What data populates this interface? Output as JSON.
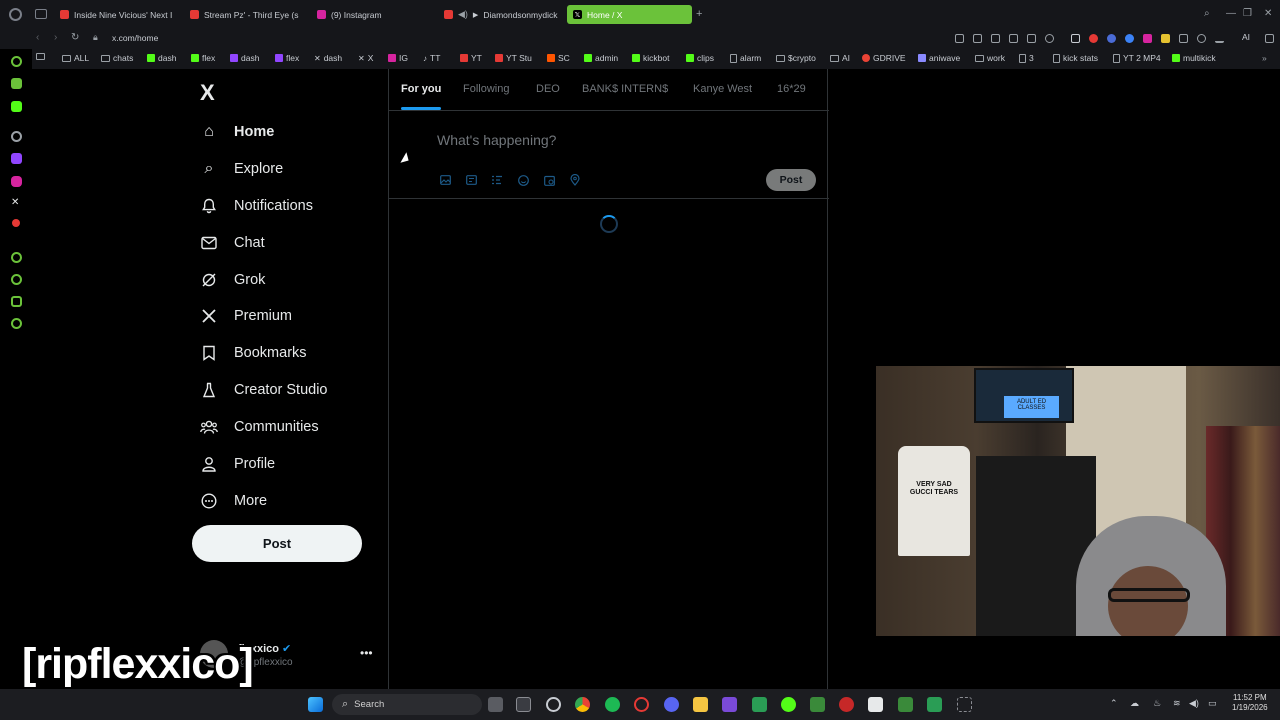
{
  "browser": {
    "tabs": [
      {
        "label": "Inside Nine Vicious' Next I",
        "color": "#e53935"
      },
      {
        "label": "Stream Pz' - Third Eye (s",
        "color": "#e53935"
      },
      {
        "label": "(9) Instagram",
        "color": "#d6249f"
      },
      {
        "label": "Diamondsonmydick",
        "color": "#e53935"
      },
      {
        "label": "Home / X",
        "color": "#000000"
      }
    ],
    "url": "x.com/home",
    "ai_label": "AI",
    "bookmarks": [
      {
        "label": "ALL",
        "icon": "folder-icon"
      },
      {
        "label": "chats",
        "icon": "folder-icon"
      },
      {
        "label": "dash",
        "icon": "kick-icon",
        "color": "#53fc18"
      },
      {
        "label": "flex",
        "icon": "kick-icon",
        "color": "#53fc18"
      },
      {
        "label": "dash",
        "icon": "twitch-icon",
        "color": "#9146ff"
      },
      {
        "label": "flex",
        "icon": "twitch-icon",
        "color": "#9146ff"
      },
      {
        "label": "dash",
        "icon": "x-icon",
        "color": "#e7e9ea"
      },
      {
        "label": "X",
        "icon": "x-icon",
        "color": "#e7e9ea"
      },
      {
        "label": "IG",
        "icon": "instagram-icon",
        "color": "#d6249f"
      },
      {
        "label": "TT",
        "icon": "tiktok-icon",
        "color": "#e7e9ea"
      },
      {
        "label": "YT",
        "icon": "youtube-icon",
        "color": "#e53935"
      },
      {
        "label": "YT Stu",
        "icon": "youtube-icon",
        "color": "#e53935"
      },
      {
        "label": "SC",
        "icon": "soundcloud-icon",
        "color": "#ff5500"
      },
      {
        "label": "admin",
        "icon": "lock-icon",
        "color": "#53fc18"
      },
      {
        "label": "kickbot",
        "icon": "kick-icon",
        "color": "#53fc18"
      },
      {
        "label": "clips",
        "icon": "kick-icon",
        "color": "#53fc18"
      },
      {
        "label": "alarm",
        "icon": "page-icon",
        "color": "#c8ccd2"
      },
      {
        "label": "$crypto",
        "icon": "folder-icon"
      },
      {
        "label": "AI",
        "icon": "folder-icon"
      },
      {
        "label": "GDRIVE",
        "icon": "google-icon",
        "color": "#ea4335"
      },
      {
        "label": "aniwave",
        "icon": "aniwave-icon",
        "color": "#8a8aff"
      },
      {
        "label": "work",
        "icon": "folder-icon"
      },
      {
        "label": "3",
        "icon": "page-icon",
        "color": "#c8ccd2"
      },
      {
        "label": "kick stats",
        "icon": "page-icon",
        "color": "#c8ccd2"
      },
      {
        "label": "YT 2 MP4",
        "icon": "page-icon",
        "color": "#c8ccd2"
      },
      {
        "label": "multikick",
        "icon": "kick-icon",
        "color": "#53fc18"
      }
    ]
  },
  "x": {
    "logo": "X",
    "nav": [
      {
        "label": "Home",
        "icon": "home-icon",
        "glyph": "⌂",
        "active": true
      },
      {
        "label": "Explore",
        "icon": "search-icon",
        "glyph": "⌕"
      },
      {
        "label": "Notifications",
        "icon": "bell-icon",
        "glyph": "♫"
      },
      {
        "label": "Chat",
        "icon": "mail-icon",
        "glyph": "✉"
      },
      {
        "label": "Grok",
        "icon": "grok-icon",
        "glyph": "⊘"
      },
      {
        "label": "Premium",
        "icon": "x-icon",
        "glyph": "✕"
      },
      {
        "label": "Bookmarks",
        "icon": "bookmark-icon",
        "glyph": "❏"
      },
      {
        "label": "Creator Studio",
        "icon": "flask-icon",
        "glyph": "♙"
      },
      {
        "label": "Communities",
        "icon": "people-icon",
        "glyph": "☷"
      },
      {
        "label": "Profile",
        "icon": "person-icon",
        "glyph": "♟"
      },
      {
        "label": "More",
        "icon": "more-icon",
        "glyph": "⋯"
      }
    ],
    "post_button": "Post",
    "profile": {
      "name": "flexxico",
      "handle": "@ripflexxico"
    },
    "timeline_tabs": [
      "For you",
      "Following",
      "DEO",
      "BANK$ INTERN$",
      "Kanye West",
      "16*29"
    ],
    "composer_placeholder": "What's happening?",
    "composer_post": "Post"
  },
  "overlay": {
    "stream_caption": "[ripflexxico]",
    "webcam_shirt_text": "VERY SAD GUCCI TEARS",
    "webcam_sign_text": "ADULT ED CLASSES"
  },
  "taskbar": {
    "search_label": "Search",
    "time": "11:52 PM",
    "date": "1/19/2026"
  },
  "colors": {
    "accent": "#1d9bf0",
    "active_tab": "#6bc23a",
    "background": "#000000"
  }
}
